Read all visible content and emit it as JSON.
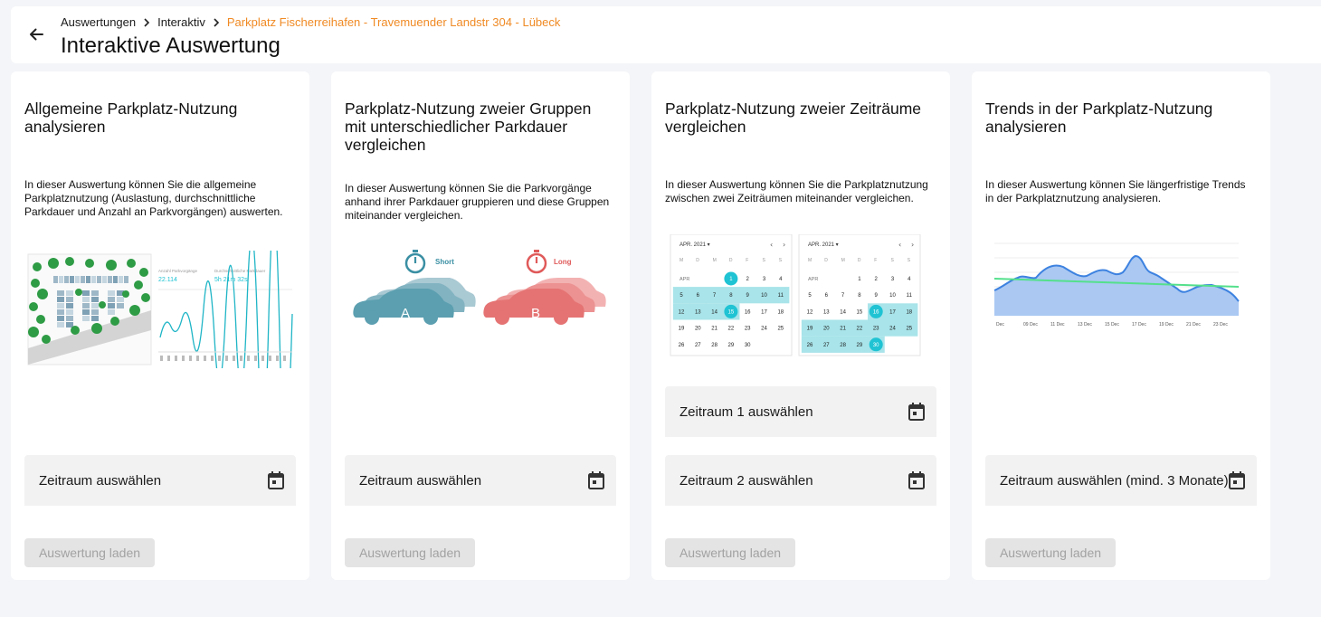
{
  "header": {
    "breadcrumbs": [
      "Auswertungen",
      "Interaktiv",
      "Parkplatz Fischerreihafen - Travemuender Landstr 304 - Lübeck"
    ],
    "title": "Interaktive Auswertung"
  },
  "colors": {
    "accent": "#f08a24",
    "teal": "#1fc3d3",
    "carA": "#5b9fb0",
    "carB": "#e57373"
  },
  "cards": [
    {
      "title": "Allgemeine Parkplatz-Nutzung analysieren",
      "description": "In dieser Auswertung können Sie die allgemeine Parkplatznutzung (Auslastung, durchschnittliche Parkdauer und Anzahl an Parkvorgängen) auswerten.",
      "illustration": {
        "stat1_label": "Anzahl Parkvorgänge",
        "stat1_value": "22.114",
        "stat2_label": "Durchschnittliche Parkdauer",
        "stat2_value": "5h 21m 32s"
      },
      "fields": [
        "Zeitraum auswählen"
      ],
      "button": "Auswertung laden"
    },
    {
      "title": "Parkplatz-Nutzung zweier Gruppen mit unterschiedlicher Parkdauer vergleichen",
      "description": "In dieser Auswertung können Sie die Parkvorgänge anhand ihrer Parkdauer gruppieren und diese Gruppen miteinander vergleichen.",
      "illustration": {
        "short_label": "Short",
        "long_label": "Long",
        "car_a": "A",
        "car_b": "B"
      },
      "fields": [
        "Zeitraum auswählen"
      ],
      "button": "Auswertung laden"
    },
    {
      "title": "Parkplatz-Nutzung zweier Zeiträume vergleichen",
      "description": "In dieser Auswertung können Sie die Parkplatznutzung zwischen zwei Zeiträumen miteinander vergleichen.",
      "illustration": {
        "month_label": "APR. 2021",
        "row_label": "APR",
        "weekdays": [
          "M",
          "D",
          "M",
          "D",
          "F",
          "S",
          "S"
        ]
      },
      "fields": [
        "Zeitraum 1 auswählen",
        "Zeitraum 2 auswählen"
      ],
      "button": "Auswertung laden"
    },
    {
      "title": "Trends in der Parkplatz-Nutzung analysieren",
      "description": "In dieser Auswertung können Sie längerfristige Trends in der Parkplatznutzung analysieren.",
      "illustration": {
        "x_labels": [
          "Dec",
          "09 Dec",
          "11 Dec",
          "13 Dec",
          "15 Dec",
          "17 Dec",
          "19 Dec",
          "21 Dec",
          "23 Dec"
        ]
      },
      "fields": [
        "Zeitraum auswählen (mind. 3 Monate)"
      ],
      "button": "Auswertung laden"
    }
  ]
}
